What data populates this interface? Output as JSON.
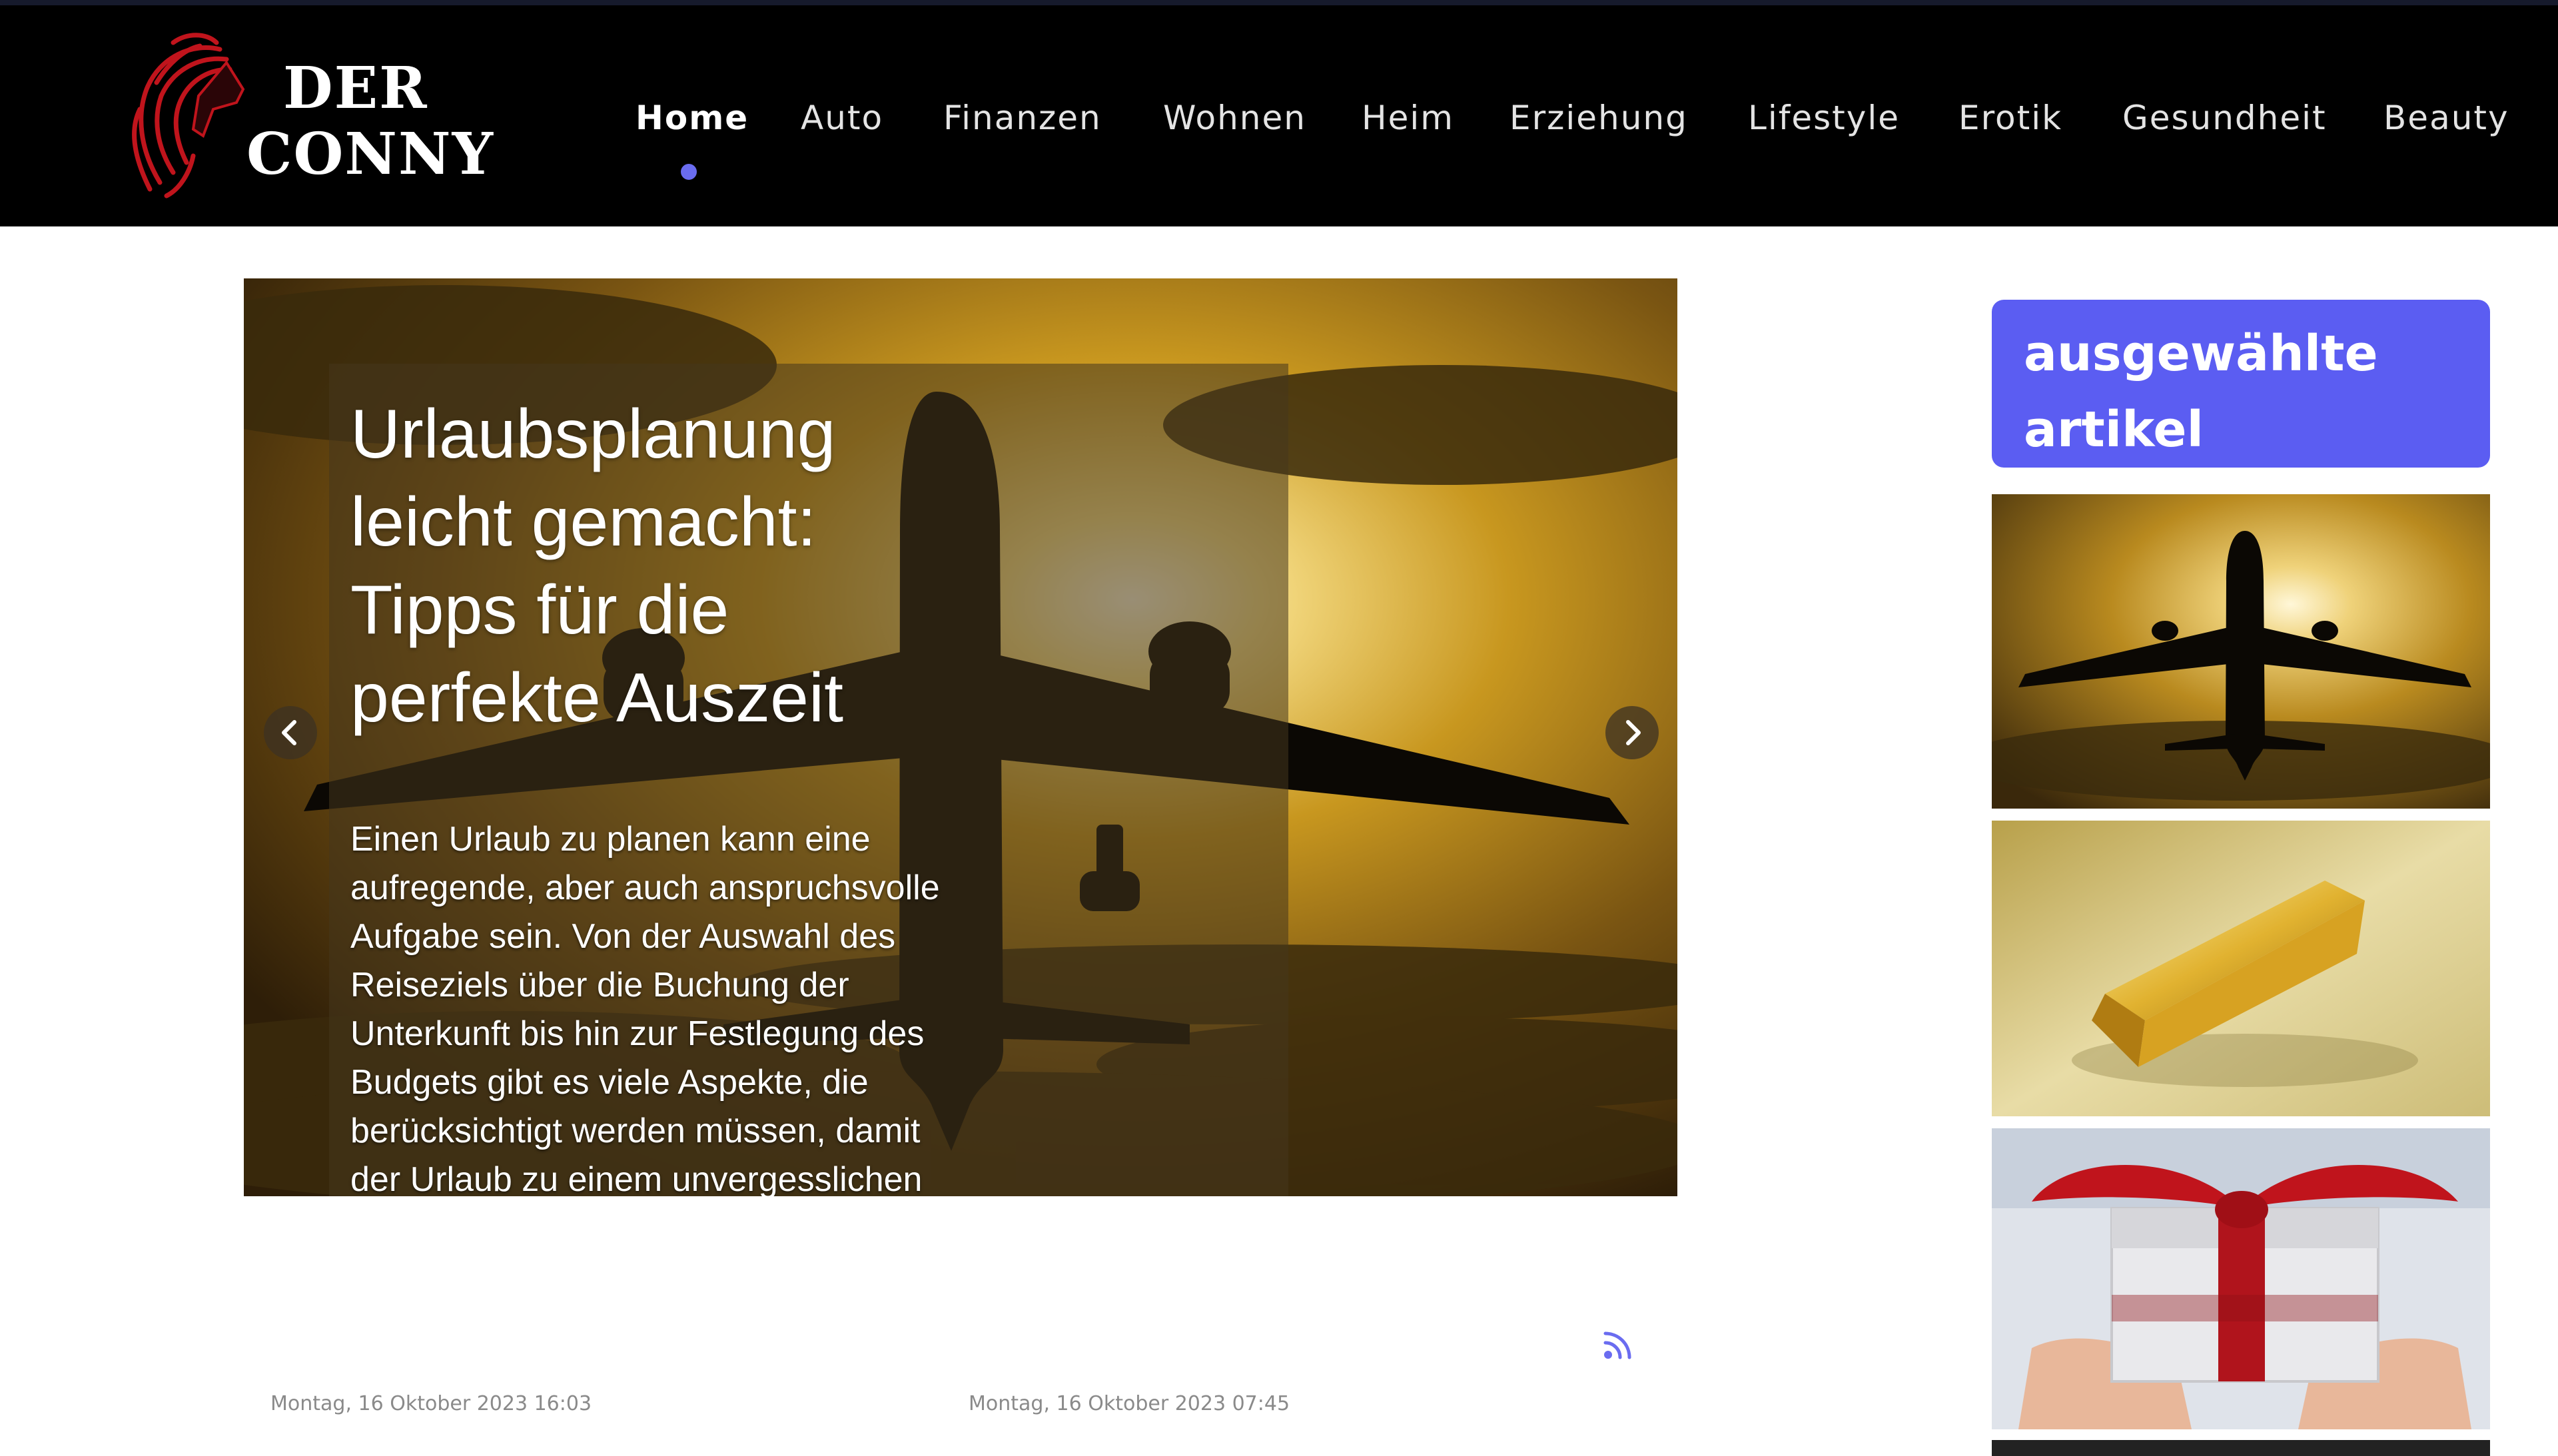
{
  "site": {
    "logo_line1": "DER",
    "logo_line2": "CONNY"
  },
  "nav": {
    "items": [
      {
        "label": "Home",
        "active": true
      },
      {
        "label": "Auto"
      },
      {
        "label": "Finanzen"
      },
      {
        "label": "Wohnen"
      },
      {
        "label": "Heim"
      },
      {
        "label": "Erziehung"
      },
      {
        "label": "Lifestyle"
      },
      {
        "label": "Erotik"
      },
      {
        "label": "Gesundheit"
      },
      {
        "label": "Beauty"
      }
    ]
  },
  "slider": {
    "title_lines": [
      "Urlaubsplanung",
      "leicht gemacht:",
      "Tipps für die",
      "perfekte Auszeit"
    ],
    "excerpt_lines": [
      "Einen Urlaub zu planen kann eine",
      "aufregende, aber auch anspruchsvolle",
      "Aufgabe sein. Von der Auswahl des",
      "Reiseziels über die Buchung der",
      "Unterkunft bis hin zur Festlegung des",
      "Budgets gibt es viele Aspekte, die",
      "berücksichtigt werden müssen, damit",
      "der Urlaub zu einem unvergesslichen"
    ],
    "prev_icon": "chevron-left-icon",
    "next_icon": "chevron-right-icon"
  },
  "posts": {
    "date_1": "Montag, 16 Oktober 2023 16:03",
    "date_2": "Montag, 16 Oktober 2023 07:45",
    "rss_icon": "rss-icon"
  },
  "sidebar": {
    "title_line1": "ausgewählte",
    "title_line2": "artikel"
  },
  "colors": {
    "header_bg": "#000000",
    "accent": "#5b5df2",
    "logo_red": "#c0141c"
  }
}
